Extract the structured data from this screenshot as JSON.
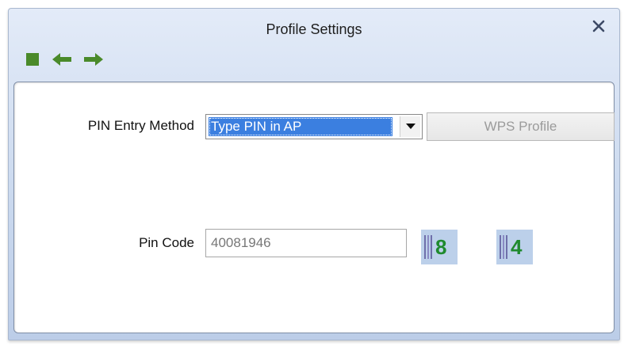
{
  "window": {
    "title": "Profile Settings"
  },
  "toolbar": {
    "icons": [
      "stop-icon",
      "back-arrow-icon",
      "forward-arrow-icon"
    ],
    "icon_color": "#4a8a2a"
  },
  "form": {
    "pin_entry_method_label": "PIN Entry Method",
    "pin_entry_method_value": "Type PIN in AP",
    "wps_profile_button": "WPS Profile",
    "pin_code_label": "Pin Code",
    "pin_code_value": "40081946",
    "captcha_digits": [
      "8",
      "4"
    ]
  },
  "colors": {
    "selection": "#3b7fe0",
    "digit": "#1f8a2e",
    "digit_bg": "#bcd0ea"
  }
}
